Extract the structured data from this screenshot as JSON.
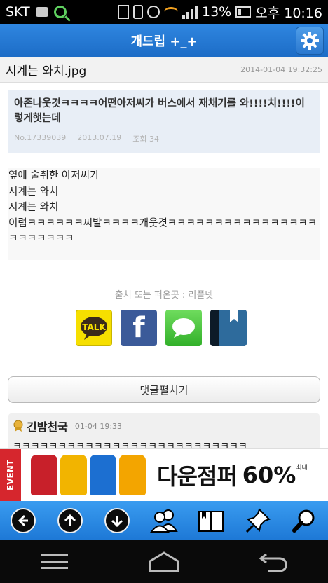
{
  "status_bar": {
    "carrier": "SKT",
    "battery": "13%",
    "time": "오후 10:16"
  },
  "app": {
    "title": "개드립 +_+"
  },
  "post": {
    "title": "시계는 와치.jpg",
    "date": "2014-01-04 19:32:25"
  },
  "quote": {
    "title": "아존나웃겻ㅋㅋㅋㅋ어떤아저씨가 버스에서 재채기를 와!!!!치!!!!이렇게햇는데",
    "number": "No.17339039",
    "date": "2013.07.19",
    "views": "조회 34"
  },
  "body": {
    "text": "옆에 술취한 아저씨가\n시계는 와치\n시계는 와치\n이럼ㅋㅋㅋㅋㅋㅋ씨발ㅋㅋㅋㅋ개웃겻ㅋㅋㅋㅋㅋㅋㅋㅋㅋㅋㅋㅋㅋㅋㅋㅋㅋㅋㅋㅋㅋㅋㅋ"
  },
  "source": {
    "text": "출처 또는 퍼온곳 : 리플넷"
  },
  "share": {
    "kakao_label": "TALK",
    "facebook_label": "f"
  },
  "comments": {
    "toggle_label": "댓글펼치기",
    "items": [
      {
        "author": "긴밤천국",
        "time": "01-04 19:33",
        "text": "ㅋㅋㅋㅋㅋㅋㅋㅋㅋㅋㅋㅋㅋㅋㅋㅋㅋㅋㅋㅋㅋㅋㅋㅋㅋㅋ"
      }
    ]
  },
  "ad": {
    "event": "EVENT",
    "headline": "다운점퍼",
    "percent": "60%",
    "small": "최대",
    "jacket_colors": [
      "#c8202a",
      "#f2b400",
      "#1c6fd1",
      "#f3a500"
    ]
  },
  "toolbar": {
    "icons": [
      "back-icon",
      "up-icon",
      "down-icon",
      "users-icon",
      "book-icon",
      "pin-icon",
      "search-icon"
    ]
  },
  "colors": {
    "appbar": "#1c6cc6",
    "toolbar": "#1d78d6"
  }
}
